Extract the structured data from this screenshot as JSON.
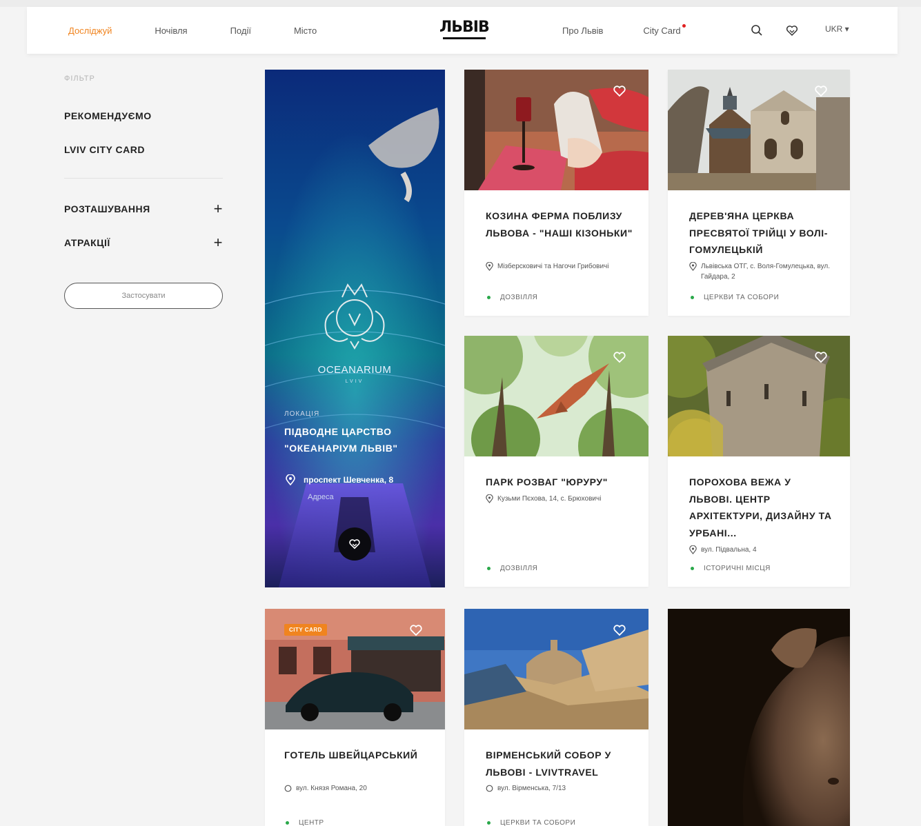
{
  "header": {
    "nav_left": [
      "Досліджуй",
      "Ночівля",
      "Події",
      "Місто"
    ],
    "logo": "ЛЬВІВ",
    "nav_right": [
      "Про Львів",
      "City Card"
    ],
    "language": "UKR ▾"
  },
  "sidebar": {
    "filter_label": "ФІЛЬТР",
    "recommended": "РЕКОМЕНДУЄМО",
    "city_card": "LVIV CITY CARD",
    "location": "РОЗТАШУВАННЯ",
    "attractions": "АТРАКЦІЇ",
    "reset": "Застосувати"
  },
  "featured": {
    "category": "ЛОКАЦІЯ",
    "title": "ПІДВОДНЕ ЦАРСТВО \"ОКЕАНАРІУМ ЛЬВІВ\"",
    "address": "проспект Шевченка, 8",
    "sub": "Адреса",
    "logo_text": "OCEANARIUM",
    "logo_sub": "LVIV"
  },
  "cards": [
    {
      "title": "КОЗИНА ФЕРМА ПОБЛИЗУ ЛЬВОВА - \"НАШІ КІЗОНЬКИ\"",
      "address": "Мізберсковичі та Нагочи Грибовичі",
      "tag": "ДОЗВІЛЛЯ"
    },
    {
      "title": "ДЕРЕВ'ЯНА ЦЕРКВА ПРЕСВЯТОЇ ТРІЙЦІ У ВОЛІ-ГОМУЛЕЦЬКІЙ",
      "address": "Львівська ОТГ, с. Воля-Гомулецька, вул. Гайдара, 2",
      "tag": "ЦЕРКВИ ТА СОБОРИ"
    },
    {
      "title": "ПАРК РОЗВАГ \"ЮРУРУ\"",
      "address": "Кузьми Пєхова, 14, с. Брюховичі",
      "tag": "ДОЗВІЛЛЯ"
    },
    {
      "title": "ПОРОХОВА ВЕЖА У ЛЬВОВІ. ЦЕНТР АРХІТЕКТУРИ, ДИЗАЙНУ ТА УРБАНІ...",
      "address": "вул. Підвальна, 4",
      "tag": "ІСТОРИЧНІ МІСЦЯ"
    },
    {
      "title": "ГОТЕЛЬ ШВЕЙЦАРСЬКИЙ",
      "address": "вул. Князя Романа, 20",
      "tag": "ЦЕНТР",
      "badge": "CITY CARD"
    },
    {
      "title": "ВІРМЕНСЬКИЙ СОБОР У ЛЬВОВІ - LVIVTRAVEL",
      "address": "вул. Вірменська, 7/13",
      "tag": "ЦЕРКВИ ТА СОБОРИ"
    }
  ]
}
